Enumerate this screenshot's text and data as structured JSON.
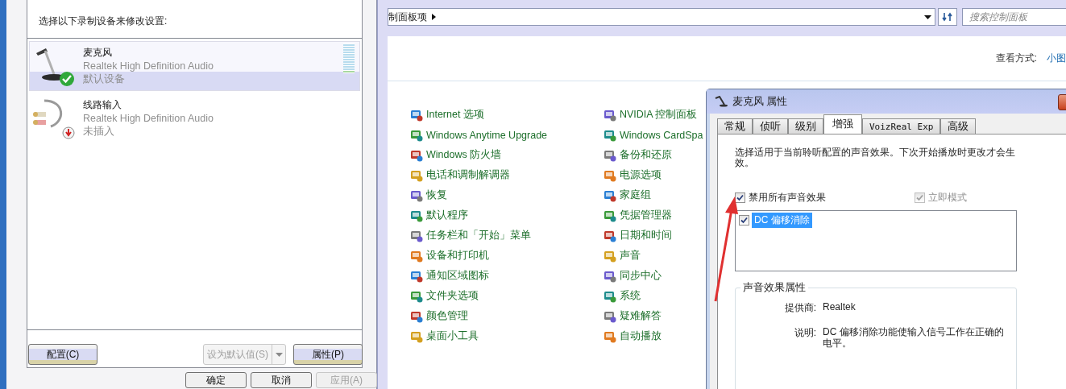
{
  "recording_dialog": {
    "instruction": "选择以下录制设备来修改设置:",
    "devices": [
      {
        "kind": "microphone",
        "name": "麦克风",
        "driver": "Realtek High Definition Audio",
        "status": "默认设备",
        "plugged_in": true,
        "selected": true,
        "level": 0.12
      },
      {
        "kind": "line_in",
        "name": "线路输入",
        "driver": "Realtek High Definition Audio",
        "status": "未插入",
        "plugged_in": false,
        "selected": false
      }
    ],
    "buttons": [
      {
        "kind": "plain",
        "label": "配置(C)",
        "disabled": false
      },
      {
        "kind": "split",
        "label": "设为默认值(S)",
        "disabled": true
      },
      {
        "kind": "plain",
        "label": "属性(P)",
        "disabled": false
      }
    ],
    "footer_buttons": [
      {
        "label": "确定",
        "disabled": false
      },
      {
        "label": "取消",
        "disabled": false
      },
      {
        "label": "应用(A)",
        "disabled": true
      }
    ]
  },
  "control_panel": {
    "address": "制面板项",
    "search": {
      "placeholder": "搜索控制面板"
    },
    "view_by": {
      "label": "查看方式:",
      "value": "小图"
    },
    "columns": [
      {
        "items": [
          "Internet 选项",
          "Windows Anytime Upgrade",
          "Windows 防火墙",
          "电话和调制解调器",
          "恢复",
          "默认程序",
          "任务栏和「开始」菜单",
          "设备和打印机",
          "通知区域图标",
          "文件夹选项",
          "颜色管理",
          "桌面小工具"
        ]
      },
      {
        "items": [
          "NVIDIA 控制面板",
          "Windows CardSpa",
          "备份和还原",
          "电源选项",
          "家庭组",
          "凭据管理器",
          "日期和时间",
          "声音",
          "同步中心",
          "系统",
          "疑难解答",
          "自动播放"
        ]
      }
    ]
  },
  "properties_dialog": {
    "title": "麦克风 属性",
    "tabs": [
      {
        "label": "常规",
        "selected": false
      },
      {
        "label": "侦听",
        "selected": false
      },
      {
        "label": "级别",
        "selected": false
      },
      {
        "label": "增强",
        "selected": true
      },
      {
        "label": "VoizReal Exp",
        "selected": false
      },
      {
        "label": "高级",
        "selected": false
      }
    ],
    "description": "选择适用于当前聆听配置的声音效果。下次开始播放时更改才会生效。",
    "disable_all": {
      "label": "禁用所有声音效果",
      "checked": true,
      "disabled": false
    },
    "immediate_mode": {
      "label": "立即模式",
      "checked": true,
      "disabled": true
    },
    "effects": [
      {
        "label": "DC 偏移消除",
        "checked": true,
        "selected": true
      }
    ],
    "group": {
      "title": "声音效果属性",
      "fields": [
        {
          "label": "提供商:",
          "value": "Realtek"
        },
        {
          "label": "说明:",
          "value": "DC 偏移消除功能使输入信号工作在正确的电平。"
        }
      ]
    }
  }
}
